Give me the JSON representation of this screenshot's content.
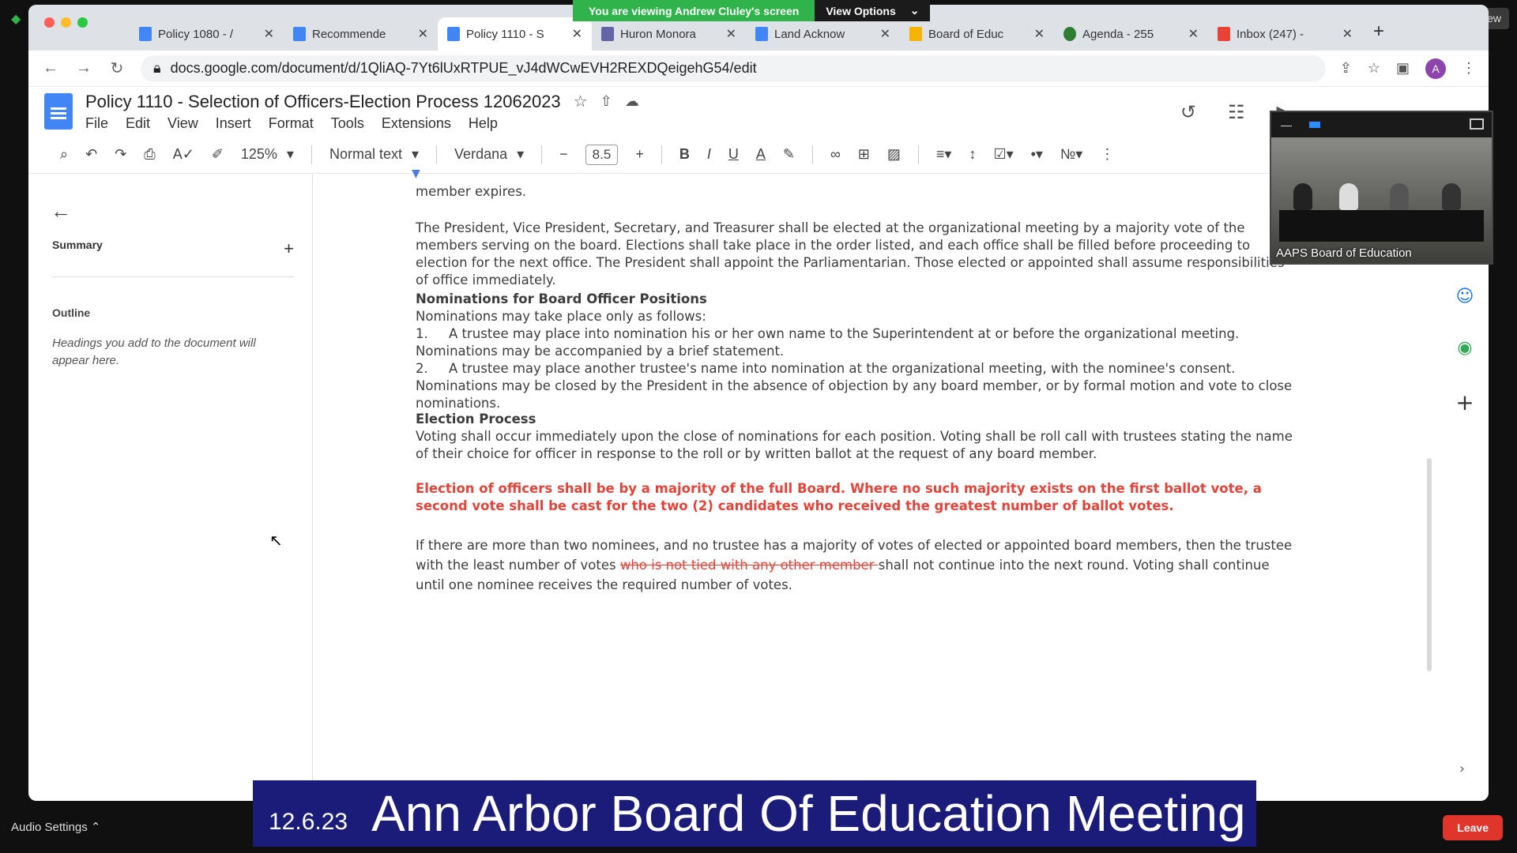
{
  "zoom": {
    "share_banner": "You are viewing Andrew Cluley's screen",
    "view_options": "View Options",
    "view_button": "View",
    "audio_settings": "Audio Settings",
    "leave": "Leave"
  },
  "browser": {
    "tabs": [
      {
        "title": "Policy 1080 - /",
        "icon": "google-docs-icon",
        "active": false
      },
      {
        "title": "Recommende",
        "icon": "google-docs-icon",
        "active": false
      },
      {
        "title": "Policy 1110 - S",
        "icon": "google-docs-icon",
        "active": true
      },
      {
        "title": "Huron Monora",
        "icon": "teams-icon",
        "active": false
      },
      {
        "title": "Land Acknow",
        "icon": "google-docs-icon",
        "active": false
      },
      {
        "title": "Board of Educ",
        "icon": "chart-icon",
        "active": false
      },
      {
        "title": "Agenda - 255",
        "icon": "tree-icon",
        "active": false
      },
      {
        "title": "Inbox (247) -",
        "icon": "gmail-icon",
        "active": false
      }
    ],
    "url": "docs.google.com/document/d/1QliAQ-7Yt6lUxRTPUE_vJ4dWCwEVH2REXDQeigehG54/edit",
    "profile_initial": "A"
  },
  "doc": {
    "title": "Policy 1110 - Selection of Officers-Election Process 12062023",
    "menus": [
      "File",
      "Edit",
      "View",
      "Insert",
      "Format",
      "Tools",
      "Extensions",
      "Help"
    ],
    "toolbar": {
      "zoom": "125%",
      "style": "Normal text",
      "font": "Verdana",
      "font_size": "8.5"
    },
    "sidebar": {
      "summary": "Summary",
      "outline": "Outline",
      "outline_hint": "Headings you add to the document will appear here."
    },
    "content": {
      "line_top": "member expires.",
      "para1": "The President, Vice President, Secretary, and Treasurer shall be elected at the organizational meeting by a majority vote of the members serving on the board.  Elections shall take place in the order listed, and each office shall be filled before proceeding to election for the next office.  The President shall appoint the Parliamentarian.  Those elected or appointed shall assume responsibilities of office immediately.",
      "nom_heading": "Nominations for Board Officer Positions",
      "nom_intro": "Nominations may take place only as follows:",
      "nom_1_num": "1.",
      "nom_1": "A trustee may place into nomination his or her own name to the Superintendent at or before the organizational meeting. Nominations may be accompanied by a brief statement.",
      "nom_2_num": "2.",
      "nom_2": "A trustee may place another trustee's name into nomination at the organizational meeting, with the nominee's consent. Nominations may be closed by the President in the absence of objection by any board member, or by formal motion and vote to close nominations.",
      "elec_heading": "Election Process",
      "elec_text": "Voting shall occur immediately upon the close of nominations for each position. Voting shall be roll call with trustees stating the name of their choice for officer in response to the roll or by written ballot at the request of any board member.",
      "red_text": "Election of officers shall be by a majority of the full Board. Where no such majority exists on the first ballot vote, a second vote shall be cast for the two (2) candidates who received the greatest number of ballot votes.",
      "last_a": "If there are more than two nominees, and no trustee has a majority of votes of elected or appointed board members, then the trustee with the least number of votes ",
      "last_strike": "who is not tied with any other member ",
      "last_b": "shall not continue into the next round. Voting shall continue until one nominee receives the required number of votes."
    }
  },
  "video": {
    "label": "AAPS Board of Education"
  },
  "caption": {
    "date": "12.6.23",
    "title": "Ann Arbor Board Of Education Meeting"
  },
  "colors": {
    "accent_red": "#e0443a",
    "docs_blue": "#4285f4",
    "zoom_green": "#2fb34a",
    "caption_bg": "#1b1b7a"
  }
}
